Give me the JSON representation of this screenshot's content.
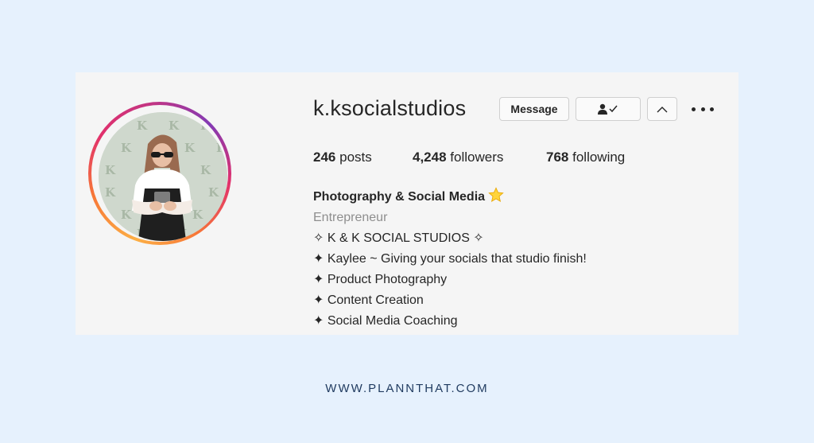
{
  "profile": {
    "username": "k.ksocialstudios",
    "message_button": "Message",
    "stats": {
      "posts_count": "246",
      "posts_label": "posts",
      "followers_count": "4,248",
      "followers_label": "followers",
      "following_count": "768",
      "following_label": "following"
    },
    "bio": {
      "name": "Photography & Social Media",
      "category": "Entrepreneur",
      "lines": [
        "✧ K & K SOCIAL STUDIOS ✧",
        "✦ Kaylee ~ Giving your socials that studio finish!",
        "✦ Product Photography",
        "✦ Content Creation",
        "✦ Social Media Coaching"
      ]
    },
    "icons": {
      "following": "person-check-icon",
      "suggestions": "chevron-up-icon",
      "more": "more-options-icon",
      "star": "star-emoji-icon"
    },
    "colors": {
      "ring_start": "#fcaf45",
      "ring_mid": "#e1306c",
      "ring_end": "#833ab4",
      "avatar_bg": "#cfd8cd",
      "page_bg": "#e6f1fd",
      "card_bg": "#f5f5f5",
      "footer_text": "#1f3a5f"
    }
  },
  "footer": {
    "url": "WWW.PLANNTHAT.COM"
  }
}
